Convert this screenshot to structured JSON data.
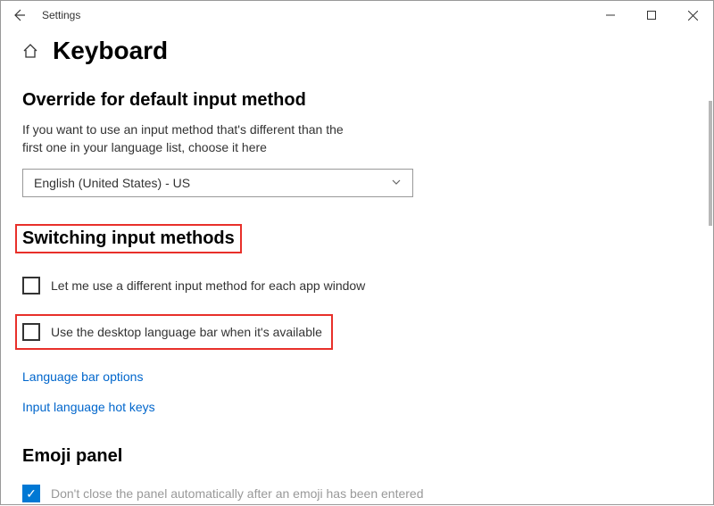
{
  "window": {
    "title": "Settings"
  },
  "page": {
    "title": "Keyboard"
  },
  "sections": {
    "override": {
      "title": "Override for default input method",
      "desc": "If you want to use an input method that's different than the first one in your language list, choose it here",
      "selected": "English (United States) - US"
    },
    "switching": {
      "title": "Switching input methods",
      "opt1": "Let me use a different input method for each app window",
      "opt2": "Use the desktop language bar when it's available",
      "link1": "Language bar options",
      "link2": "Input language hot keys"
    },
    "emoji": {
      "title": "Emoji panel",
      "opt1": "Don't close the panel automatically after an emoji has been entered"
    }
  }
}
